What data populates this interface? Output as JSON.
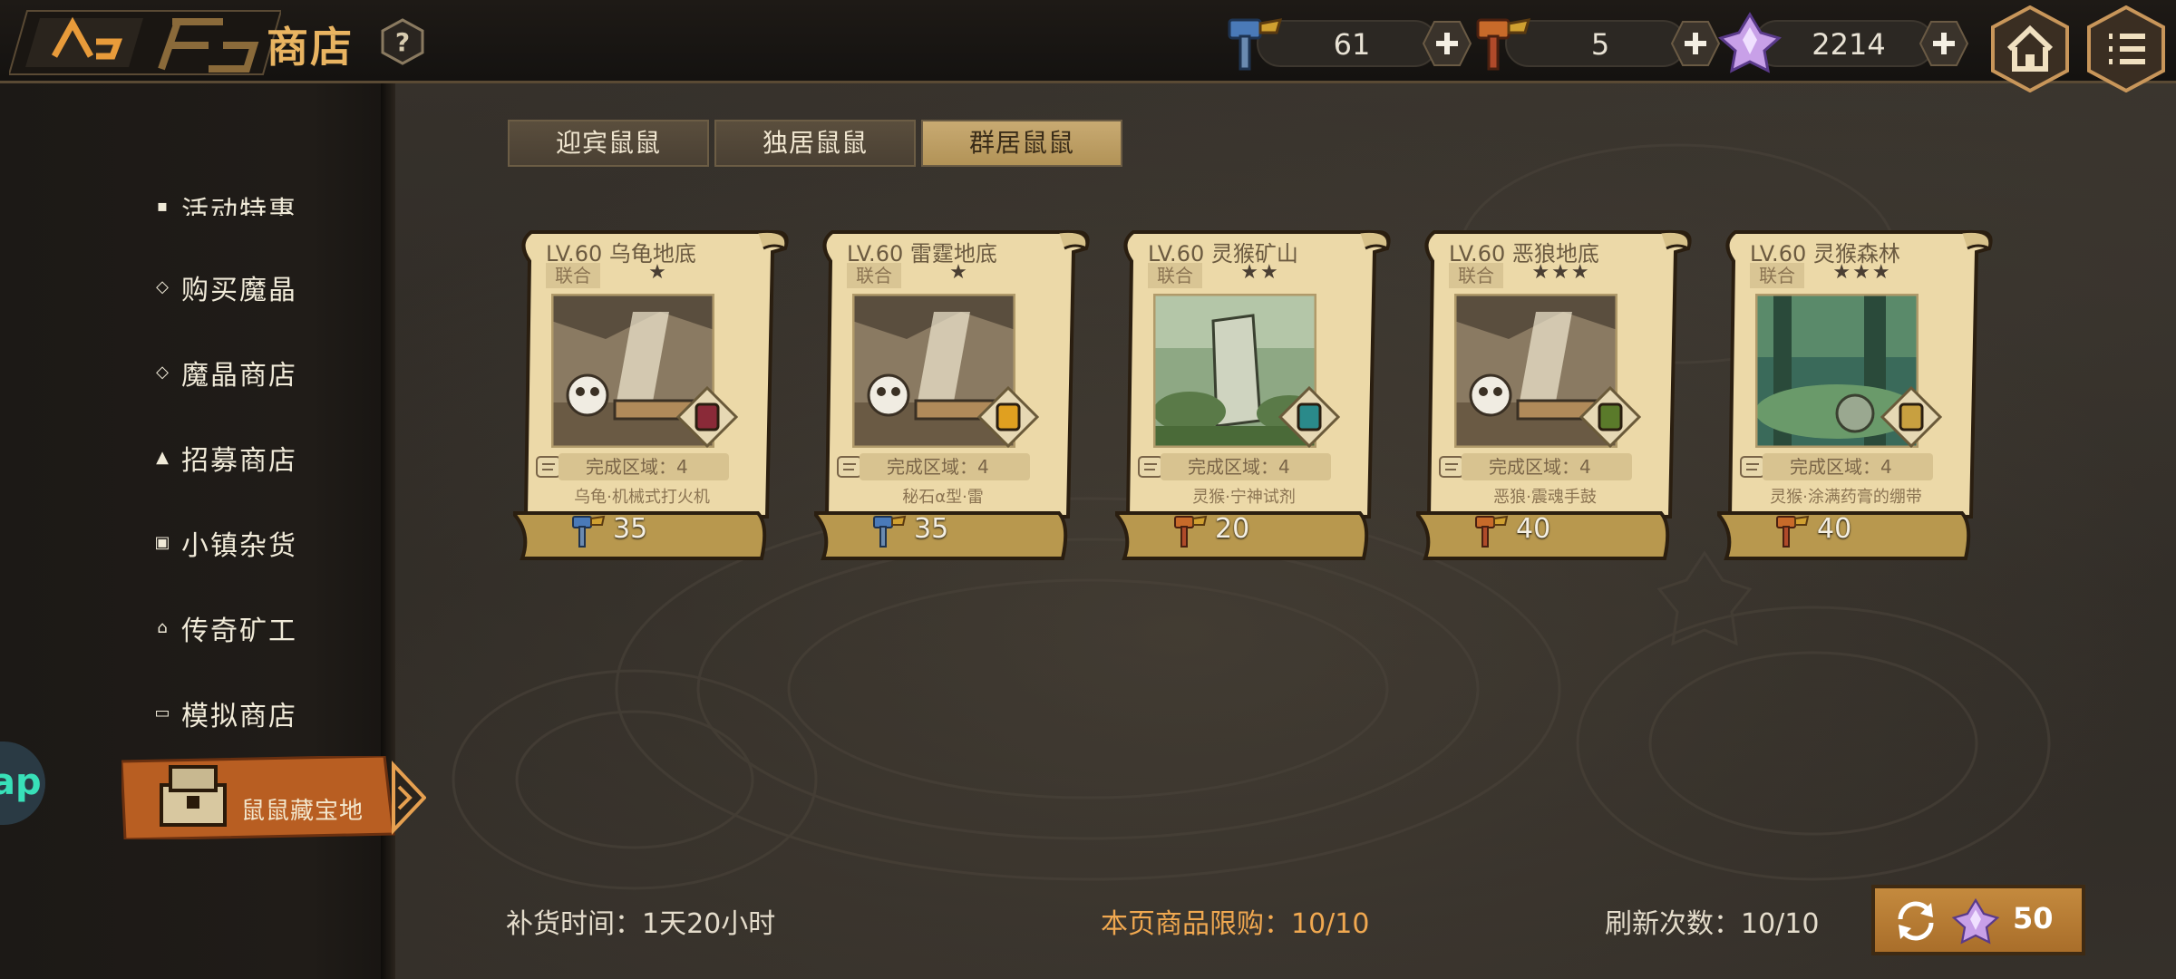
{
  "header": {
    "title": "商店",
    "resources": [
      {
        "name": "blue-hammer",
        "value": "61"
      },
      {
        "name": "orange-hammer",
        "value": "5"
      },
      {
        "name": "magic-crystal",
        "value": "2214"
      }
    ]
  },
  "sidebar": {
    "items": [
      {
        "label": "活动特惠",
        "icon": "grid-icon"
      },
      {
        "label": "购买魔晶",
        "icon": "diamond-icon"
      },
      {
        "label": "魔晶商店",
        "icon": "diamond-icon"
      },
      {
        "label": "招募商店",
        "icon": "bell-icon"
      },
      {
        "label": "小镇杂货",
        "icon": "box-icon"
      },
      {
        "label": "传奇矿工",
        "icon": "house-icon"
      },
      {
        "label": "模拟商店",
        "icon": "monitor-icon"
      }
    ],
    "active": {
      "label": "鼠鼠藏宝地"
    },
    "edge_badge": "ap"
  },
  "tabs": [
    {
      "label": "迎宾鼠鼠",
      "selected": false
    },
    {
      "label": "独居鼠鼠",
      "selected": false
    },
    {
      "label": "群居鼠鼠",
      "selected": true
    }
  ],
  "cards": [
    {
      "title": "LV.60 乌龟地底",
      "tag": "联合",
      "stars": "★",
      "area": "完成区域：4",
      "desc": "乌龟·机械式打火机",
      "price": "35",
      "currency": "blue-hammer",
      "scene": "cave",
      "item_color": "#8a2a38"
    },
    {
      "title": "LV.60 雷霆地底",
      "tag": "联合",
      "stars": "★",
      "area": "完成区域：4",
      "desc": "秘石α型·雷",
      "price": "35",
      "currency": "blue-hammer",
      "scene": "cave",
      "item_color": "#e0a020"
    },
    {
      "title": "LV.60 灵猴矿山",
      "tag": "联合",
      "stars": "★★",
      "area": "完成区域：4",
      "desc": "灵猴·宁神试剂",
      "price": "20",
      "currency": "orange-hammer",
      "scene": "mountain",
      "item_color": "#2a8a8a"
    },
    {
      "title": "LV.60 恶狼地底",
      "tag": "联合",
      "stars": "★★★",
      "area": "完成区域：4",
      "desc": "恶狼·震魂手鼓",
      "price": "40",
      "currency": "orange-hammer",
      "scene": "cave",
      "item_color": "#5a7a2a"
    },
    {
      "title": "LV.60 灵猴森林",
      "tag": "联合",
      "stars": "★★★",
      "area": "完成区域：4",
      "desc": "灵猴·涂满药膏的绷带",
      "price": "40",
      "currency": "orange-hammer",
      "scene": "forest",
      "item_color": "#c8a040"
    }
  ],
  "footer": {
    "restock": "补货时间：1天20小时",
    "limit": "本页商品限购：10/10",
    "refresh_count": "刷新次数：10/10",
    "refresh_cost": "50"
  },
  "colors": {
    "accent": "#e9b461",
    "parchment": "#ecd9a8",
    "orange_highlight": "#f0a850"
  }
}
